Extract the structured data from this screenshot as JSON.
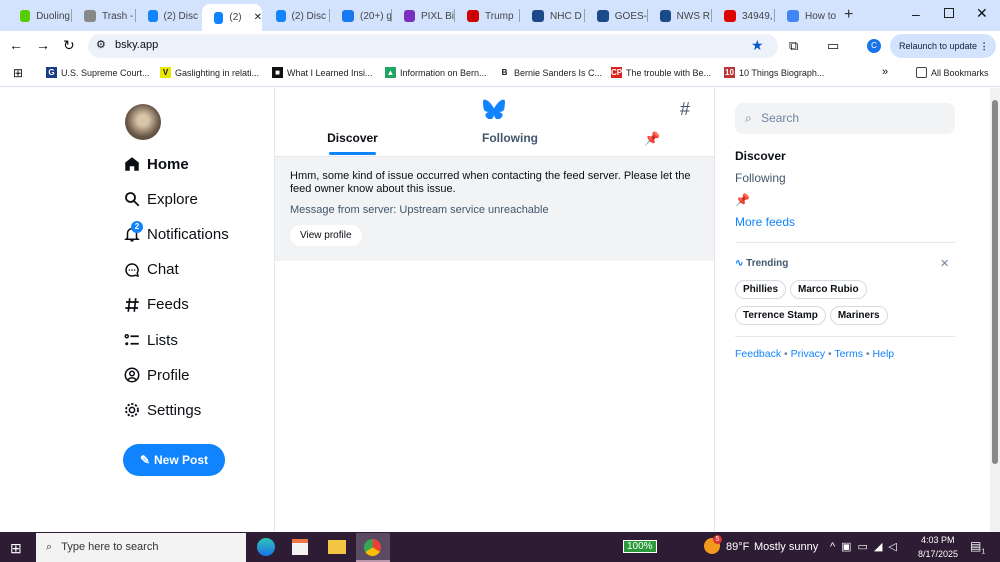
{
  "browser": {
    "tabs": [
      {
        "label": "Duoling",
        "color": "#58cc02"
      },
      {
        "label": "Trash -",
        "color": "#888"
      },
      {
        "label": "(2) Disc",
        "color": "#1083fe"
      },
      {
        "label": "(2)",
        "color": "#1083fe",
        "active": true
      },
      {
        "label": "(2) Disc",
        "color": "#1083fe"
      },
      {
        "label": "(20+) g",
        "color": "#1877f2"
      },
      {
        "label": "PIXL Bi",
        "color": "#7b2fbf"
      },
      {
        "label": "Trump",
        "color": "#c00"
      },
      {
        "label": "NHC D",
        "color": "#1a4a8a"
      },
      {
        "label": "GOES-",
        "color": "#1a4a8a"
      },
      {
        "label": "NWS R",
        "color": "#1a4a8a"
      },
      {
        "label": "34949,",
        "color": "#d00"
      },
      {
        "label": "How to",
        "color": "#4285f4"
      }
    ],
    "url": "bsky.app",
    "relaunch_label": "Relaunch to update",
    "profile_initial": "C",
    "bookmarks": [
      {
        "label": "U.S. Supreme Court...",
        "icon": "G",
        "color": "#1a3a8a"
      },
      {
        "label": "Gaslighting in relati...",
        "icon": "V",
        "color": "#e8e800"
      },
      {
        "label": "What I Learned Insi...",
        "icon": "■",
        "color": "#111"
      },
      {
        "label": "Information on Bern...",
        "icon": "▲",
        "color": "#1fa463"
      },
      {
        "label": "Bernie Sanders Is C...",
        "icon": "B",
        "color": "#fff"
      },
      {
        "label": "The trouble with Be...",
        "icon": "CP",
        "color": "#d22"
      },
      {
        "label": "10 Things Biograph...",
        "icon": "10",
        "color": "#b33"
      }
    ],
    "all_bookmarks": "All Bookmarks"
  },
  "sidebar": {
    "items": [
      {
        "label": "Home",
        "icon": "home-icon"
      },
      {
        "label": "Explore",
        "icon": "search-icon"
      },
      {
        "label": "Notifications",
        "icon": "bell-icon",
        "badge": "2"
      },
      {
        "label": "Chat",
        "icon": "chat-icon"
      },
      {
        "label": "Feeds",
        "icon": "hash-icon"
      },
      {
        "label": "Lists",
        "icon": "list-icon"
      },
      {
        "label": "Profile",
        "icon": "profile-icon"
      },
      {
        "label": "Settings",
        "icon": "gear-icon"
      }
    ],
    "new_post": "New Post"
  },
  "main": {
    "tabs": [
      "Discover",
      "Following"
    ],
    "error_text": "Hmm, some kind of issue occurred when contacting the feed server. Please let the feed owner know about this issue.",
    "server_message": "Message from server: Upstream service unreachable",
    "view_profile": "View profile"
  },
  "right": {
    "search_placeholder": "Search",
    "feeds": [
      "Discover",
      "Following"
    ],
    "more_feeds": "More feeds",
    "trending_title": "Trending",
    "trending": [
      "Phillies",
      "Marco Rubio",
      "Terrence Stamp",
      "Mariners"
    ],
    "footer": [
      "Feedback",
      "Privacy",
      "Terms",
      "Help"
    ]
  },
  "taskbar": {
    "search_placeholder": "Type here to search",
    "battery": "100%",
    "weather_temp": "89°F",
    "weather_desc": "Mostly sunny",
    "weather_badge": "5",
    "time": "4:03 PM",
    "date": "8/17/2025",
    "notif_count": "1"
  }
}
